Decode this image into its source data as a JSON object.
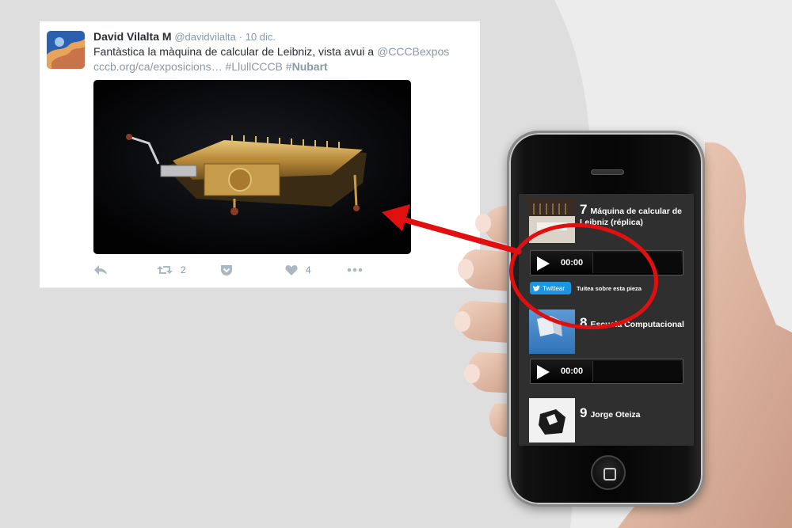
{
  "tweet": {
    "author_name": "David Vilalta M",
    "handle": "@davidvilalta",
    "separator": "·",
    "date": "10 dic.",
    "text_main": "Fantàstica la màquina de calcular de Leibniz, vista avui a ",
    "mention": "@CCCBexpos",
    "link": "cccb.org/ca/exposicions…",
    "hashtag1": "#LlullCCCB",
    "hashtag2_prefix": "#",
    "hashtag2_bold": "Nubart",
    "retweet_count": "2",
    "like_count": "4",
    "icons": [
      "reply-icon",
      "retweet-icon",
      "save-pocket-icon",
      "heart-icon",
      "more-icon"
    ],
    "link_color": "#8899a6"
  },
  "phone": {
    "items": [
      {
        "number": "7",
        "title": "Máquina de calcular de Leibniz (réplica)",
        "time": "00:00"
      },
      {
        "number": "8",
        "title": "Escuela Computacional",
        "time": "00:00"
      },
      {
        "number": "9",
        "title": "Jorge Oteiza"
      }
    ],
    "twitter_button": "Twittear",
    "tweet_prompt": "Tuitea sobre esta pieza"
  },
  "annotation": {
    "color": "#e01010"
  }
}
